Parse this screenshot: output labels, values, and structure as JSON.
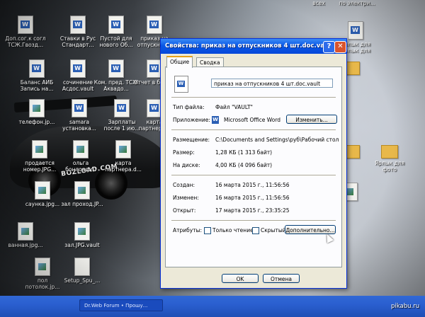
{
  "dialog": {
    "title": "Свойства: приказ на отпускников 4 шт.doc.vault",
    "help_glyph": "?",
    "close_glyph": "✕",
    "tabs": [
      {
        "label": "Общие"
      },
      {
        "label": "Сводка"
      }
    ],
    "file_name": "приказ на отпускников 4 шт.doc.vault",
    "file_type_label": "Тип файла:",
    "file_type_value": "Файл \"VAULT\"",
    "app_label": "Приложение:",
    "app_value": "Microsoft Office Word",
    "change_button": "Изменить...",
    "location_label": "Размещение:",
    "location_value": "C:\\Documents and Settings\\руб\\Рабочий стол",
    "size_label": "Размер:",
    "size_value": "1,28 КБ (1 313 байт)",
    "disk_label": "На диске:",
    "disk_value": "4,00 КБ (4 096 байт)",
    "created_label": "Создан:",
    "created_value": "16 марта 2015 г., 11:56:56",
    "modified_label": "Изменен:",
    "modified_value": "16 марта 2015 г., 11:56:56",
    "opened_label": "Открыт:",
    "opened_value": "17 марта 2015 г., 23:35:25",
    "attributes_label": "Атрибуты:",
    "readonly_label": "Только чтение",
    "hidden_label": "Скрытый",
    "advanced_button": "Дополнительно...",
    "ok_button": "OK",
    "cancel_button": "Отмена"
  },
  "desktop": {
    "car_logo": "BOZLOAD.COM",
    "icons": [
      {
        "label": "Доп.сог.к согл ТСЖ.Гвозд..."
      },
      {
        "label": "Ставки в Рус Стандарт..."
      },
      {
        "label": "Пустой для нового Об..."
      },
      {
        "label": "приказ на отпускник..."
      },
      {
        "label": "Баланс АИБ Запись на..."
      },
      {
        "label": "сочинение Асдос.vault"
      },
      {
        "label": "Ком. пред. ТСЖ Аквадо..."
      },
      {
        "label": "Отчет в банк..."
      },
      {
        "label": "телефон.jp..."
      },
      {
        "label": "samara установка..."
      },
      {
        "label": "Зарплаты после 1 ию..."
      },
      {
        "label": "карта партнеро..."
      },
      {
        "label": "продается номер.JPG..."
      },
      {
        "label": "ольга бонлоад.ru"
      },
      {
        "label": "карта партнера.d..."
      },
      {
        "label": "саунка.jpg..."
      },
      {
        "label": "зал проход.JP..."
      },
      {
        "label": "ванная.jpg..."
      },
      {
        "label": "зал.JPG.vault"
      },
      {
        "label": "пол потолок.jp..."
      },
      {
        "label": "Setup_Spu_..."
      },
      {
        "label": "всех"
      },
      {
        "label": "по электри..."
      },
      {
        "label": "Ярлык для Ярлык для"
      },
      {
        "label": "Ярлык для фото"
      }
    ]
  },
  "taskbar": {
    "task_label": "Dr.Web Forum • Прошу..."
  },
  "watermark": "pikabu.ru"
}
